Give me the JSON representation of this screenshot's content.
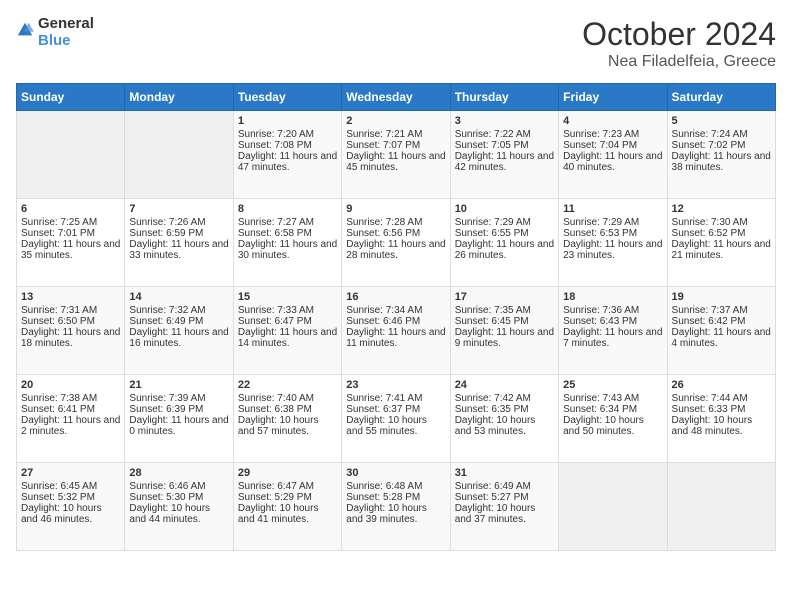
{
  "header": {
    "logo_general": "General",
    "logo_blue": "Blue",
    "month": "October 2024",
    "location": "Nea Filadelfeia, Greece"
  },
  "weekdays": [
    "Sunday",
    "Monday",
    "Tuesday",
    "Wednesday",
    "Thursday",
    "Friday",
    "Saturday"
  ],
  "weeks": [
    [
      {
        "day": "",
        "empty": true
      },
      {
        "day": "",
        "empty": true
      },
      {
        "day": "1",
        "sunrise": "Sunrise: 7:20 AM",
        "sunset": "Sunset: 7:08 PM",
        "daylight": "Daylight: 11 hours and 47 minutes."
      },
      {
        "day": "2",
        "sunrise": "Sunrise: 7:21 AM",
        "sunset": "Sunset: 7:07 PM",
        "daylight": "Daylight: 11 hours and 45 minutes."
      },
      {
        "day": "3",
        "sunrise": "Sunrise: 7:22 AM",
        "sunset": "Sunset: 7:05 PM",
        "daylight": "Daylight: 11 hours and 42 minutes."
      },
      {
        "day": "4",
        "sunrise": "Sunrise: 7:23 AM",
        "sunset": "Sunset: 7:04 PM",
        "daylight": "Daylight: 11 hours and 40 minutes."
      },
      {
        "day": "5",
        "sunrise": "Sunrise: 7:24 AM",
        "sunset": "Sunset: 7:02 PM",
        "daylight": "Daylight: 11 hours and 38 minutes."
      }
    ],
    [
      {
        "day": "6",
        "sunrise": "Sunrise: 7:25 AM",
        "sunset": "Sunset: 7:01 PM",
        "daylight": "Daylight: 11 hours and 35 minutes."
      },
      {
        "day": "7",
        "sunrise": "Sunrise: 7:26 AM",
        "sunset": "Sunset: 6:59 PM",
        "daylight": "Daylight: 11 hours and 33 minutes."
      },
      {
        "day": "8",
        "sunrise": "Sunrise: 7:27 AM",
        "sunset": "Sunset: 6:58 PM",
        "daylight": "Daylight: 11 hours and 30 minutes."
      },
      {
        "day": "9",
        "sunrise": "Sunrise: 7:28 AM",
        "sunset": "Sunset: 6:56 PM",
        "daylight": "Daylight: 11 hours and 28 minutes."
      },
      {
        "day": "10",
        "sunrise": "Sunrise: 7:29 AM",
        "sunset": "Sunset: 6:55 PM",
        "daylight": "Daylight: 11 hours and 26 minutes."
      },
      {
        "day": "11",
        "sunrise": "Sunrise: 7:29 AM",
        "sunset": "Sunset: 6:53 PM",
        "daylight": "Daylight: 11 hours and 23 minutes."
      },
      {
        "day": "12",
        "sunrise": "Sunrise: 7:30 AM",
        "sunset": "Sunset: 6:52 PM",
        "daylight": "Daylight: 11 hours and 21 minutes."
      }
    ],
    [
      {
        "day": "13",
        "sunrise": "Sunrise: 7:31 AM",
        "sunset": "Sunset: 6:50 PM",
        "daylight": "Daylight: 11 hours and 18 minutes."
      },
      {
        "day": "14",
        "sunrise": "Sunrise: 7:32 AM",
        "sunset": "Sunset: 6:49 PM",
        "daylight": "Daylight: 11 hours and 16 minutes."
      },
      {
        "day": "15",
        "sunrise": "Sunrise: 7:33 AM",
        "sunset": "Sunset: 6:47 PM",
        "daylight": "Daylight: 11 hours and 14 minutes."
      },
      {
        "day": "16",
        "sunrise": "Sunrise: 7:34 AM",
        "sunset": "Sunset: 6:46 PM",
        "daylight": "Daylight: 11 hours and 11 minutes."
      },
      {
        "day": "17",
        "sunrise": "Sunrise: 7:35 AM",
        "sunset": "Sunset: 6:45 PM",
        "daylight": "Daylight: 11 hours and 9 minutes."
      },
      {
        "day": "18",
        "sunrise": "Sunrise: 7:36 AM",
        "sunset": "Sunset: 6:43 PM",
        "daylight": "Daylight: 11 hours and 7 minutes."
      },
      {
        "day": "19",
        "sunrise": "Sunrise: 7:37 AM",
        "sunset": "Sunset: 6:42 PM",
        "daylight": "Daylight: 11 hours and 4 minutes."
      }
    ],
    [
      {
        "day": "20",
        "sunrise": "Sunrise: 7:38 AM",
        "sunset": "Sunset: 6:41 PM",
        "daylight": "Daylight: 11 hours and 2 minutes."
      },
      {
        "day": "21",
        "sunrise": "Sunrise: 7:39 AM",
        "sunset": "Sunset: 6:39 PM",
        "daylight": "Daylight: 11 hours and 0 minutes."
      },
      {
        "day": "22",
        "sunrise": "Sunrise: 7:40 AM",
        "sunset": "Sunset: 6:38 PM",
        "daylight": "Daylight: 10 hours and 57 minutes."
      },
      {
        "day": "23",
        "sunrise": "Sunrise: 7:41 AM",
        "sunset": "Sunset: 6:37 PM",
        "daylight": "Daylight: 10 hours and 55 minutes."
      },
      {
        "day": "24",
        "sunrise": "Sunrise: 7:42 AM",
        "sunset": "Sunset: 6:35 PM",
        "daylight": "Daylight: 10 hours and 53 minutes."
      },
      {
        "day": "25",
        "sunrise": "Sunrise: 7:43 AM",
        "sunset": "Sunset: 6:34 PM",
        "daylight": "Daylight: 10 hours and 50 minutes."
      },
      {
        "day": "26",
        "sunrise": "Sunrise: 7:44 AM",
        "sunset": "Sunset: 6:33 PM",
        "daylight": "Daylight: 10 hours and 48 minutes."
      }
    ],
    [
      {
        "day": "27",
        "sunrise": "Sunrise: 6:45 AM",
        "sunset": "Sunset: 5:32 PM",
        "daylight": "Daylight: 10 hours and 46 minutes."
      },
      {
        "day": "28",
        "sunrise": "Sunrise: 6:46 AM",
        "sunset": "Sunset: 5:30 PM",
        "daylight": "Daylight: 10 hours and 44 minutes."
      },
      {
        "day": "29",
        "sunrise": "Sunrise: 6:47 AM",
        "sunset": "Sunset: 5:29 PM",
        "daylight": "Daylight: 10 hours and 41 minutes."
      },
      {
        "day": "30",
        "sunrise": "Sunrise: 6:48 AM",
        "sunset": "Sunset: 5:28 PM",
        "daylight": "Daylight: 10 hours and 39 minutes."
      },
      {
        "day": "31",
        "sunrise": "Sunrise: 6:49 AM",
        "sunset": "Sunset: 5:27 PM",
        "daylight": "Daylight: 10 hours and 37 minutes."
      },
      {
        "day": "",
        "empty": true
      },
      {
        "day": "",
        "empty": true
      }
    ]
  ]
}
